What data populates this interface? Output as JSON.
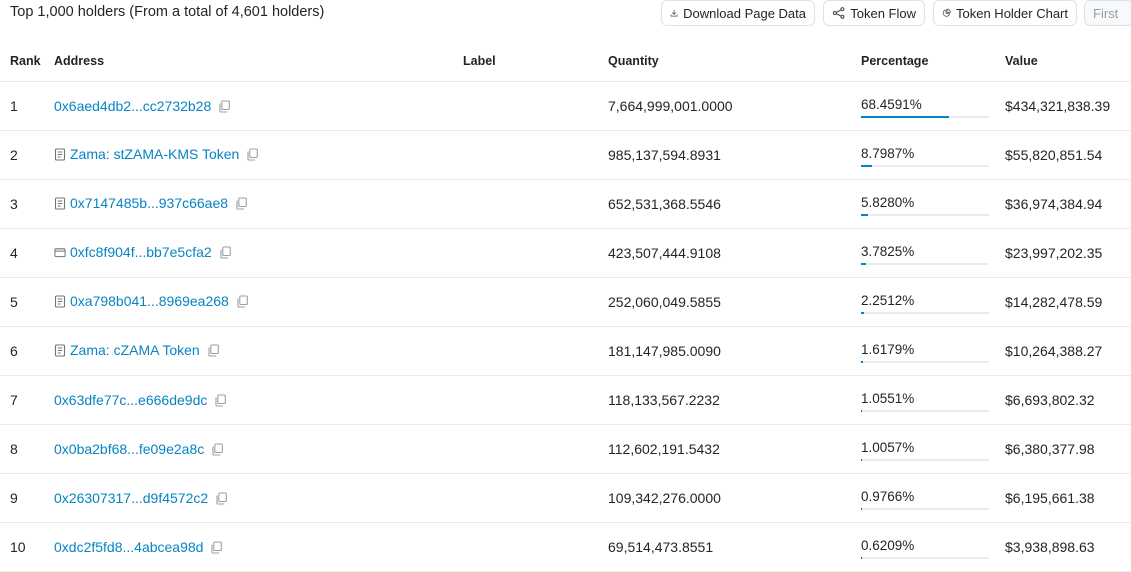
{
  "summary": "Top 1,000 holders (From a total of 4,601 holders)",
  "buttons": {
    "download": "Download Page Data",
    "flow": "Token Flow",
    "chart": "Token Holder Chart",
    "first": "First"
  },
  "headers": {
    "rank": "Rank",
    "address": "Address",
    "label": "Label",
    "quantity": "Quantity",
    "percentage": "Percentage",
    "value": "Value"
  },
  "colors": {
    "link": "#0784c3",
    "bar": "#0784c3"
  },
  "rows": [
    {
      "rank": "1",
      "address": "0x6aed4db2...cc2732b28",
      "icon": "none",
      "label": "",
      "quantity": "7,664,999,001.0000",
      "percentage": "68.4591%",
      "pct": 68.4591,
      "value": "$434,321,838.39"
    },
    {
      "rank": "2",
      "address": "Zama: stZAMA-KMS Token",
      "icon": "contract-icon",
      "label": "",
      "quantity": "985,137,594.8931",
      "percentage": "8.7987%",
      "pct": 8.7987,
      "value": "$55,820,851.54"
    },
    {
      "rank": "3",
      "address": "0x7147485b...937c66ae8",
      "icon": "contract-icon",
      "label": "",
      "quantity": "652,531,368.5546",
      "percentage": "5.8280%",
      "pct": 5.828,
      "value": "$36,974,384.94"
    },
    {
      "rank": "4",
      "address": "0xfc8f904f...bb7e5cfa2",
      "icon": "wallet-icon",
      "label": "",
      "quantity": "423,507,444.9108",
      "percentage": "3.7825%",
      "pct": 3.7825,
      "value": "$23,997,202.35"
    },
    {
      "rank": "5",
      "address": "0xa798b041...8969ea268",
      "icon": "contract-icon",
      "label": "",
      "quantity": "252,060,049.5855",
      "percentage": "2.2512%",
      "pct": 2.2512,
      "value": "$14,282,478.59"
    },
    {
      "rank": "6",
      "address": "Zama: cZAMA Token",
      "icon": "contract-icon",
      "label": "",
      "quantity": "181,147,985.0090",
      "percentage": "1.6179%",
      "pct": 1.6179,
      "value": "$10,264,388.27"
    },
    {
      "rank": "7",
      "address": "0x63dfe77c...e666de9dc",
      "icon": "none",
      "label": "",
      "quantity": "118,133,567.2232",
      "percentage": "1.0551%",
      "pct": 1.0551,
      "value": "$6,693,802.32"
    },
    {
      "rank": "8",
      "address": "0x0ba2bf68...fe09e2a8c",
      "icon": "none",
      "label": "",
      "quantity": "112,602,191.5432",
      "percentage": "1.0057%",
      "pct": 1.0057,
      "value": "$6,380,377.98"
    },
    {
      "rank": "9",
      "address": "0x26307317...d9f4572c2",
      "icon": "none",
      "label": "",
      "quantity": "109,342,276.0000",
      "percentage": "0.9766%",
      "pct": 0.9766,
      "value": "$6,195,661.38"
    },
    {
      "rank": "10",
      "address": "0xdc2f5fd8...4abcea98d",
      "icon": "none",
      "label": "",
      "quantity": "69,514,473.8551",
      "percentage": "0.6209%",
      "pct": 0.6209,
      "value": "$3,938,898.63"
    }
  ]
}
